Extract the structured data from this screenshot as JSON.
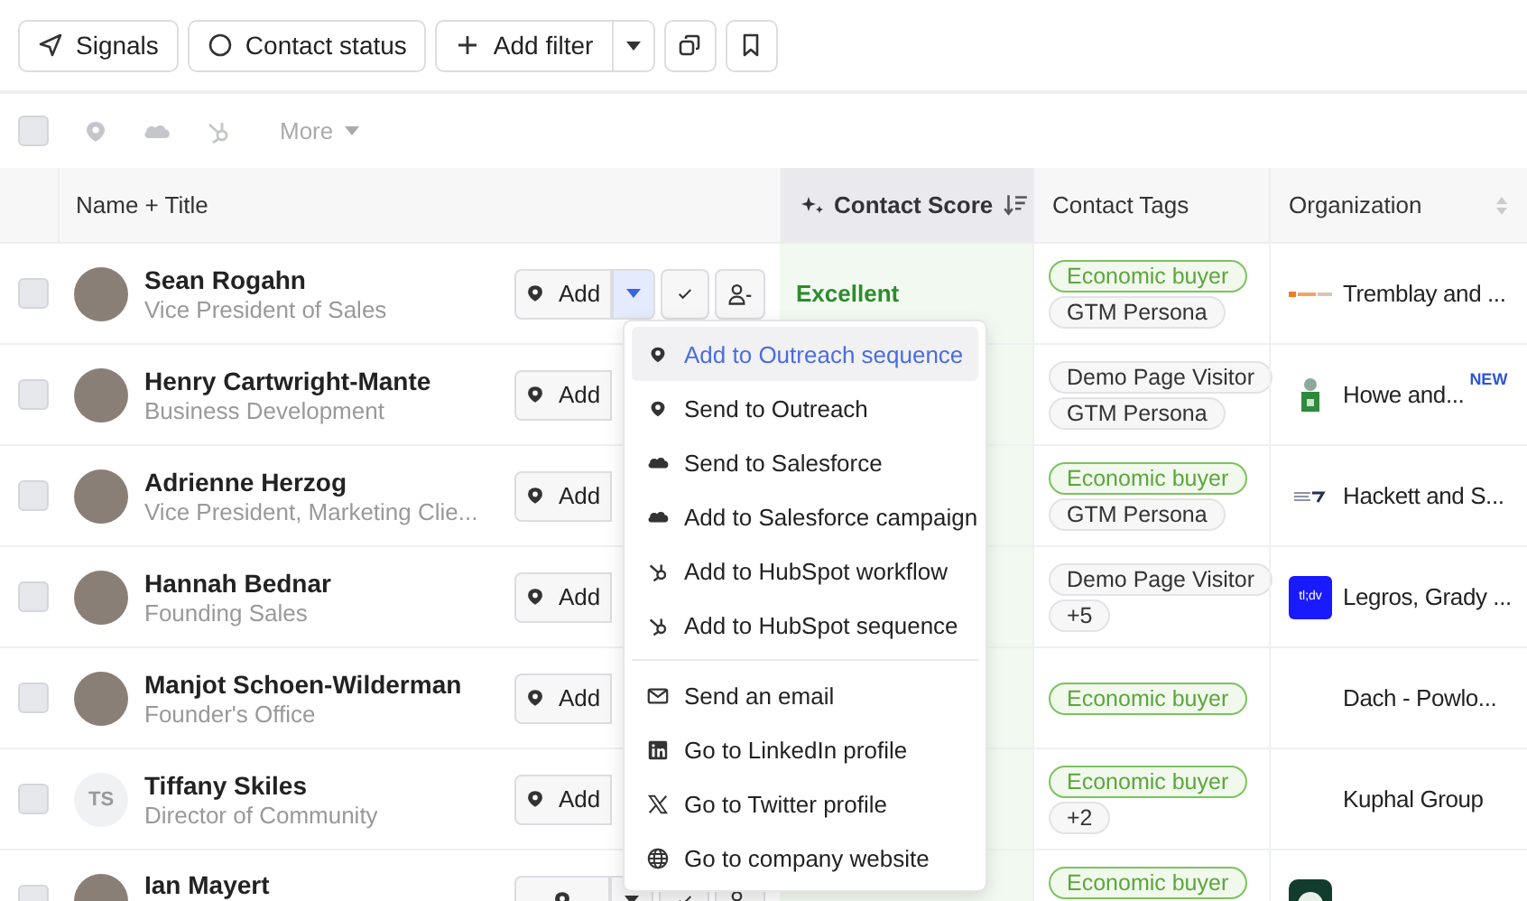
{
  "toolbar": {
    "signals": "Signals",
    "contact_status": "Contact status",
    "add_filter": "Add filter"
  },
  "bulk_bar": {
    "checked": false,
    "more": "More"
  },
  "columns": [
    {
      "label": "Name + Title",
      "sorted": false,
      "kind": "name"
    },
    {
      "label": "Contact Score",
      "sorted": true,
      "kind": "score"
    },
    {
      "label": "Contact Tags",
      "sorted": false,
      "kind": "tags"
    },
    {
      "label": "Organization",
      "sorted": false,
      "kind": "org"
    }
  ],
  "rows": [
    {
      "checked": false,
      "avatar": {
        "kind": "photo"
      },
      "name": "Sean Rogahn",
      "title": "Vice President of Sales",
      "hovered": true,
      "menu_open": true,
      "add": "Add",
      "score": "Excellent",
      "tags": [
        {
          "label": "Economic buyer",
          "kind": "economic"
        },
        {
          "label": "GTM Persona",
          "kind": "plain"
        }
      ],
      "org": {
        "name": "Tremblay and ...",
        "logo": {
          "kind": "wordmark"
        }
      }
    },
    {
      "checked": false,
      "avatar": {
        "kind": "photo"
      },
      "name": "Henry Cartwright-Mante",
      "title": "Business Development",
      "hovered": false,
      "add": "Add",
      "tags": [
        {
          "label": "Demo Page Visitor",
          "kind": "plain"
        },
        {
          "label": "GTM Persona",
          "kind": "plain"
        }
      ],
      "org": {
        "name": "Howe and...",
        "logo": {
          "kind": "figure"
        },
        "badge": "NEW"
      }
    },
    {
      "checked": false,
      "avatar": {
        "kind": "photo"
      },
      "name": "Adrienne Herzog",
      "title": "Vice President, Marketing Clie...",
      "hovered": false,
      "add": "Add",
      "tags": [
        {
          "label": "Economic buyer",
          "kind": "economic"
        },
        {
          "label": "GTM Persona",
          "kind": "plain"
        }
      ],
      "org": {
        "name": "Hackett and S...",
        "logo": {
          "kind": "arrow"
        }
      }
    },
    {
      "checked": false,
      "avatar": {
        "kind": "photo"
      },
      "name": "Hannah Bednar",
      "title": "Founding Sales",
      "hovered": false,
      "add": "Add",
      "tags": [
        {
          "label": "Demo Page Visitor",
          "kind": "plain"
        },
        {
          "label": "+5",
          "kind": "plain"
        }
      ],
      "org": {
        "name": "Legros, Grady ...",
        "logo": {
          "kind": "text",
          "text": "tl;dv"
        }
      }
    },
    {
      "checked": false,
      "avatar": {
        "kind": "photo"
      },
      "name": "Manjot Schoen-Wilderman",
      "title": "Founder's Office",
      "hovered": false,
      "add": "Add",
      "tags": [
        {
          "label": "Economic buyer",
          "kind": "economic"
        }
      ],
      "org": {
        "name": "Dach - Powlo..."
      }
    },
    {
      "checked": false,
      "avatar": {
        "kind": "initials",
        "initials": "TS"
      },
      "name": "Tiffany Skiles",
      "title": "Director of Community",
      "hovered": false,
      "add": "Add",
      "tags": [
        {
          "label": "Economic buyer",
          "kind": "economic"
        },
        {
          "label": "+2",
          "kind": "plain"
        }
      ],
      "org": {
        "name": "Kuphal Group"
      }
    },
    {
      "checked": false,
      "avatar": {
        "kind": "photo"
      },
      "name": "Ian Mayert",
      "hovered": true,
      "menu_open": false,
      "tags": [
        {
          "label": "Economic buyer",
          "kind": "economic"
        }
      ],
      "org": {
        "logo": {
          "kind": "badge"
        }
      }
    }
  ],
  "menu": {
    "groups": [
      [
        {
          "label": "Add to Outreach sequence",
          "kind": "outreach",
          "selected": true
        },
        {
          "label": "Send to Outreach",
          "kind": "outreach",
          "selected": false
        },
        {
          "label": "Send to Salesforce",
          "kind": "salesforce",
          "selected": false
        },
        {
          "label": "Add to Salesforce campaign",
          "kind": "salesforce",
          "selected": false
        },
        {
          "label": "Add to HubSpot workflow",
          "kind": "hubspot",
          "selected": false
        },
        {
          "label": "Add to HubSpot sequence",
          "kind": "hubspot",
          "selected": false
        }
      ],
      [
        {
          "label": "Send an email",
          "kind": "email",
          "selected": false
        },
        {
          "label": "Go to LinkedIn profile",
          "kind": "linkedin",
          "selected": false
        },
        {
          "label": "Go to Twitter profile",
          "kind": "x",
          "selected": false
        },
        {
          "label": "Go to company website",
          "kind": "globe",
          "selected": false
        }
      ]
    ]
  }
}
